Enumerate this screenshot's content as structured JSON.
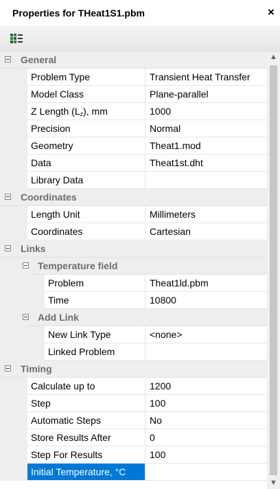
{
  "window": {
    "title": "Properties for THeat1S1.pbm",
    "close": "×"
  },
  "toolbar": {
    "icon": "properties-grid-icon"
  },
  "categories": {
    "general": "General",
    "coordinates": "Coordinates",
    "links": "Links",
    "temperature_field": "Temperature field",
    "add_link": "Add Link",
    "timing": "Timing"
  },
  "props": {
    "problem_type": {
      "name": "Problem Type",
      "value": "Transient Heat Transfer"
    },
    "model_class": {
      "name": "Model Class",
      "value": "Plane-parallel"
    },
    "z_length": {
      "name_pre": "Z Length (L",
      "name_sub": "z",
      "name_post": "), mm",
      "value": "1000"
    },
    "precision": {
      "name": "Precision",
      "value": "Normal"
    },
    "geometry": {
      "name": "Geometry",
      "value": "Theat1.mod"
    },
    "data": {
      "name": "Data",
      "value": "Theat1st.dht"
    },
    "library_data": {
      "name": "Library Data",
      "value": ""
    },
    "length_unit": {
      "name": "Length Unit",
      "value": "Millimeters"
    },
    "coordinates": {
      "name": "Coordinates",
      "value": "Cartesian"
    },
    "tf_problem": {
      "name": "Problem",
      "value": "Theat1ld.pbm"
    },
    "tf_time": {
      "name": "Time",
      "value": "10800"
    },
    "new_link_type": {
      "name": "New Link Type",
      "value": "<none>"
    },
    "linked_problem": {
      "name": "Linked Problem",
      "value": ""
    },
    "calculate_up_to": {
      "name": "Calculate up to",
      "value": "1200"
    },
    "step": {
      "name": "Step",
      "value": "100"
    },
    "automatic_steps": {
      "name": "Automatic Steps",
      "value": "No"
    },
    "store_results_after": {
      "name": "Store Results After",
      "value": "0"
    },
    "step_for_results": {
      "name": "Step For Results",
      "value": "100"
    },
    "initial_temperature": {
      "name": "Initial Temperature, °C",
      "value": ""
    }
  },
  "scrollbar": {
    "up": "▲",
    "down": "▼"
  }
}
